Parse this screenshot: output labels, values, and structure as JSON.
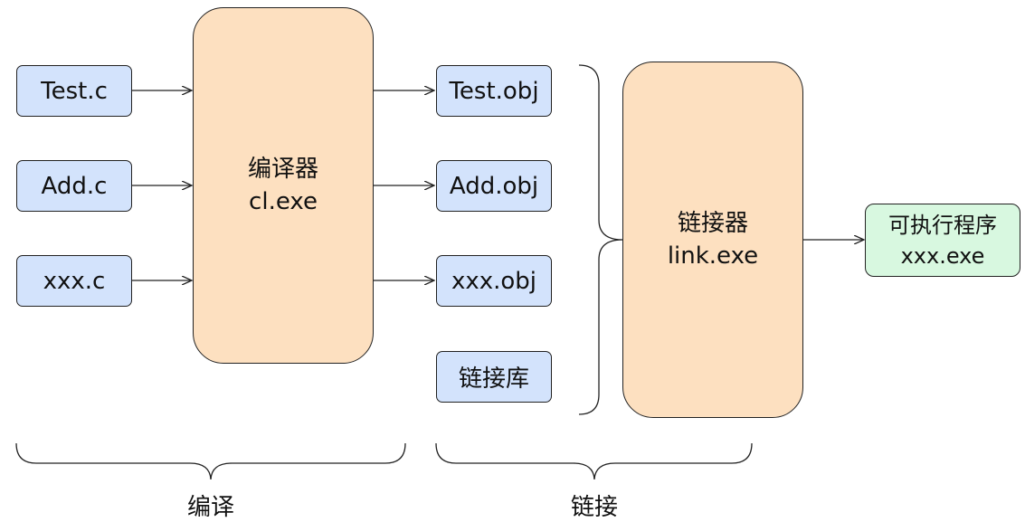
{
  "sources": [
    "Test.c",
    "Add.c",
    "xxx.c"
  ],
  "compiler": {
    "name": "编译器",
    "exe": "cl.exe"
  },
  "objects": [
    "Test.obj",
    "Add.obj",
    "xxx.obj"
  ],
  "library": "链接库",
  "linker": {
    "name": "链接器",
    "exe": "link.exe"
  },
  "output": {
    "name": "可执行程序",
    "exe": "xxx.exe"
  },
  "stages": {
    "compile": "编译",
    "link": "链接"
  },
  "colors": {
    "source_fill": "#d3e3fc",
    "tool_fill": "#fde0c0",
    "output_fill": "#d8f8e0",
    "stroke": "#222222"
  }
}
